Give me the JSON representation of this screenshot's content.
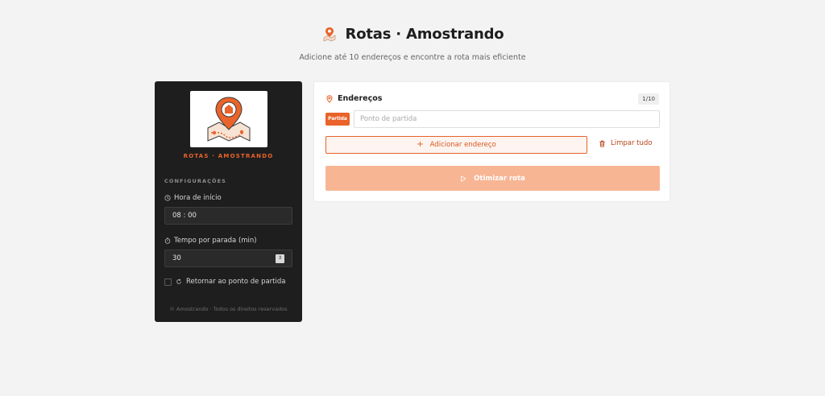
{
  "header": {
    "title": "Rotas · Amostrando",
    "subtitle": "Adicione até 10 endereços e encontre a rota mais eficiente",
    "icon": "map-pin-icon"
  },
  "sidebar": {
    "brand_caption": "ROTAS · AMOSTRANDO",
    "section_title": "CONFIGURAÇÕES",
    "start_time": {
      "label": "Hora de início",
      "value": "08 : 00",
      "icon": "clock-icon"
    },
    "time_per_stop": {
      "label": "Tempo por parada (min)",
      "value": "30",
      "icon": "timer-icon"
    },
    "return_option": {
      "label": "Retornar ao ponto de partida",
      "checked": false,
      "icon": "refresh-icon"
    },
    "footer": "© Amostrando · Todos os direitos reservados"
  },
  "addresses": {
    "title": "Endereços",
    "count": "1/10",
    "start_badge": "Partida",
    "start_placeholder": "Ponto de partida",
    "add_label": "Adicionar endereço",
    "clear_label": "Limpar tudo",
    "optimize_label": "Otimizar rota"
  },
  "colors": {
    "accent": "#e9632a",
    "accent_disabled": "#f8b594",
    "sidebar_bg": "#1e1e1e",
    "page_bg": "#f3f3f3"
  }
}
